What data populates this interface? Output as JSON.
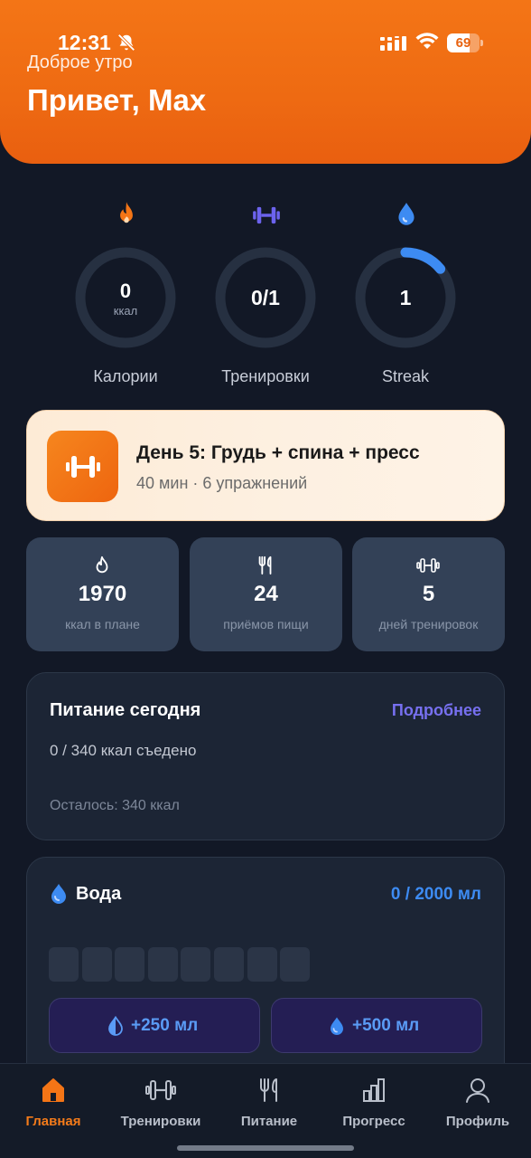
{
  "status_bar": {
    "time": "12:31",
    "battery": "69",
    "battery_level": 0.69
  },
  "header": {
    "greeting": "Доброе утро",
    "title": "Привет, Max"
  },
  "rings": [
    {
      "value": "0",
      "unit": "ккал",
      "label": "Калории",
      "icon": "flame-icon",
      "progress": 0
    },
    {
      "value": "0/1",
      "unit": "",
      "label": "Тренировки",
      "icon": "dumbbell-icon",
      "progress": 0
    },
    {
      "value": "1",
      "unit": "",
      "label": "Streak",
      "icon": "drop-icon",
      "progress": 0.14
    }
  ],
  "workout": {
    "title": "День 5: Грудь + спина + пресс",
    "subtitle": "40 мин · 6 упражнений"
  },
  "stats": [
    {
      "value": "1970",
      "label": "ккал в плане",
      "icon": "flame-icon"
    },
    {
      "value": "24",
      "label": "приёмов пищи",
      "icon": "fork-knife-icon"
    },
    {
      "value": "5",
      "label": "дней тренировок",
      "icon": "dumbbell-icon"
    }
  ],
  "nutrition": {
    "title": "Питание сегодня",
    "link": "Подробнее",
    "eaten": "0 / 340 ккал съедено",
    "remaining": "Осталось: 340 ккал"
  },
  "water": {
    "title": "Вода",
    "amount": "0 / 2000 мл",
    "glasses_filled": 0,
    "glasses_total": 8,
    "add_small": "+250 мл",
    "add_large": "+500 мл"
  },
  "nav": [
    {
      "label": "Главная",
      "icon": "home-icon",
      "active": true
    },
    {
      "label": "Тренировки",
      "icon": "dumbbell-icon",
      "active": false
    },
    {
      "label": "Питание",
      "icon": "fork-knife-icon",
      "active": false
    },
    {
      "label": "Прогресс",
      "icon": "bar-chart-icon",
      "active": false
    },
    {
      "label": "Профиль",
      "icon": "user-icon",
      "active": false
    }
  ],
  "colors": {
    "accent": "#f47516",
    "background": "#121826",
    "ring_progress": "#3d8bf2",
    "link": "#7770f0",
    "water": "#3d8bf2"
  }
}
